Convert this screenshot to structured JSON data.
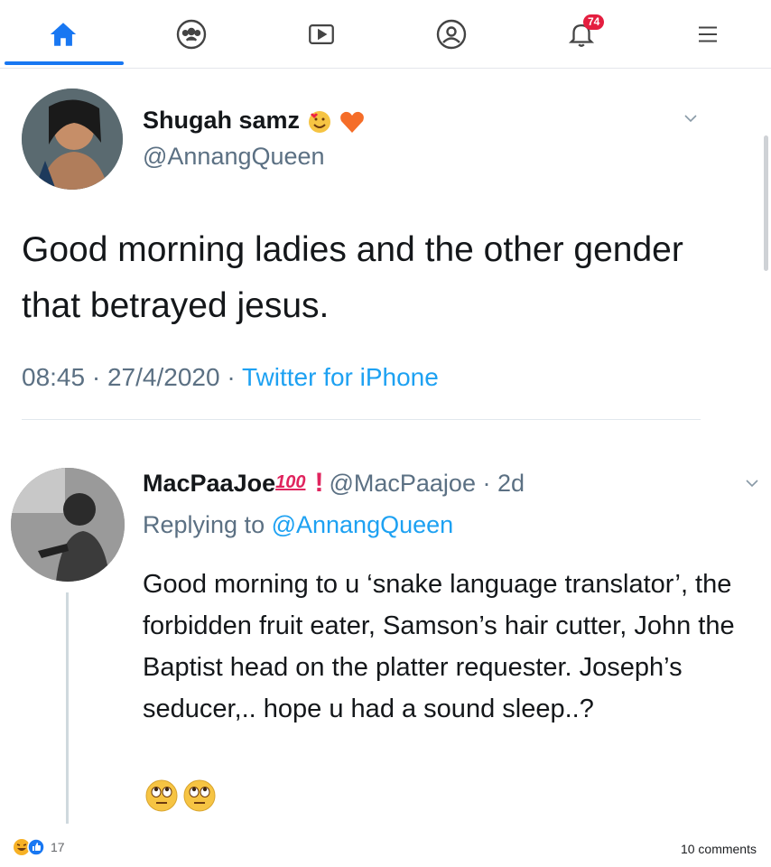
{
  "nav": {
    "items": [
      {
        "name": "home-icon",
        "active": true
      },
      {
        "name": "groups-icon"
      },
      {
        "name": "watch-icon"
      },
      {
        "name": "profile-icon"
      },
      {
        "name": "notifications-icon",
        "badge": "74"
      },
      {
        "name": "menu-icon"
      }
    ],
    "accent": "#1877f2",
    "badge_color": "#e41e3f"
  },
  "tweet": {
    "display_name": "Shugah samz",
    "name_emojis": [
      "smiling-face-with-hearts",
      "orange-heart"
    ],
    "handle": "@AnnangQueen",
    "text": "Good morning ladies and the other gender that betrayed jesus.",
    "time": "08:45",
    "date": "27/4/2020",
    "source": "Twitter for iPhone",
    "separator": " · "
  },
  "reply": {
    "display_name": "MacPaaJoe",
    "hundred": "100",
    "exclaim": "!",
    "handle": "@MacPaajoe",
    "age": "2d",
    "replying_prefix": "Replying to ",
    "replying_to": "@AnnangQueen",
    "text": "Good morning to u ‘snake language translator’, the forbidden fruit eater, Samson’s hair cutter, John the Baptist head on the platter requester. Joseph’s seducer,.. hope u had a sound sleep..?",
    "emojis": [
      "face-with-rolling-eyes",
      "face-with-rolling-eyes"
    ]
  },
  "footer": {
    "reaction_count": "17",
    "comments": "10 comments"
  }
}
